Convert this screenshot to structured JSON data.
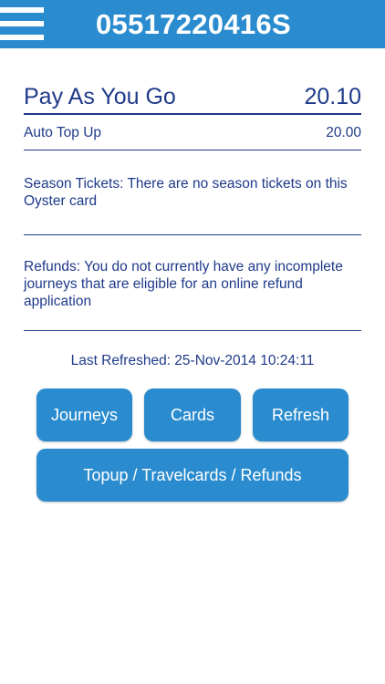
{
  "header": {
    "card_number": "05517220416S"
  },
  "balance": {
    "payg_label": "Pay As You Go",
    "payg_value": "20.10",
    "auto_topup_label": "Auto Top Up",
    "auto_topup_value": "20.00"
  },
  "season": {
    "text": "Season Tickets: There are no season tickets on this Oyster card"
  },
  "refunds": {
    "text": "Refunds: You do not currently have any incomplete journeys that are eligible for an online refund application"
  },
  "status": {
    "last_refreshed": "Last Refreshed: 25-Nov-2014 10:24:11"
  },
  "buttons": {
    "journeys": "Journeys",
    "cards": "Cards",
    "refresh": "Refresh",
    "topup": "Topup / Travelcards / Refunds"
  },
  "colors": {
    "header_bg": "#2a8ccf",
    "text_primary": "#1f3a8a",
    "button_bg": "#2a8ccf"
  }
}
